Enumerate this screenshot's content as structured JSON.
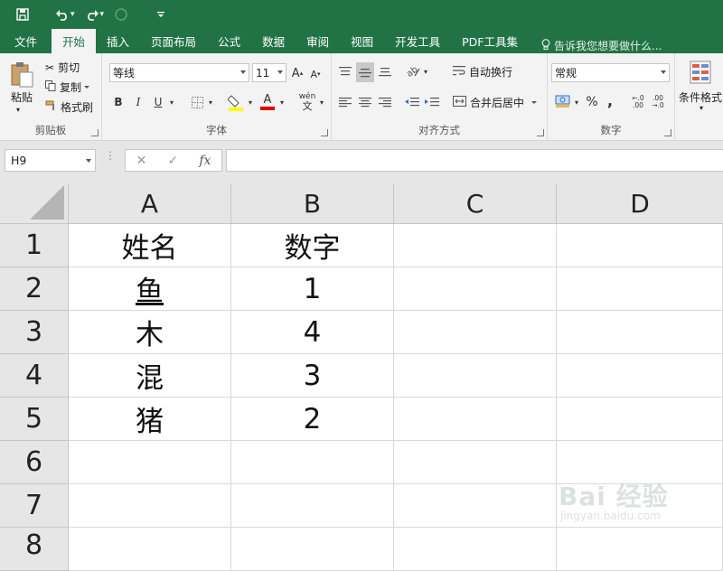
{
  "quick_access": {
    "save_icon": "save-icon",
    "undo_icon": "undo-icon",
    "redo_icon": "redo-icon",
    "customize_icon": "customize-icon"
  },
  "tabs": [
    {
      "label": "文件"
    },
    {
      "label": "开始"
    },
    {
      "label": "插入"
    },
    {
      "label": "页面布局"
    },
    {
      "label": "公式"
    },
    {
      "label": "数据"
    },
    {
      "label": "审阅"
    },
    {
      "label": "视图"
    },
    {
      "label": "开发工具"
    },
    {
      "label": "PDF工具集"
    }
  ],
  "active_tab": "开始",
  "tell_me": "告诉我您想要做什么...",
  "ribbon": {
    "clipboard": {
      "label": "剪贴板",
      "paste": "粘贴",
      "cut": "剪切",
      "copy": "复制",
      "format_painter": "格式刷"
    },
    "font": {
      "label": "字体",
      "font_name": "等线",
      "font_size": "11",
      "grow": "A",
      "shrink": "A",
      "bold": "B",
      "italic": "I",
      "underline": "U",
      "wen": "wén",
      "font_color_a": "A"
    },
    "alignment": {
      "label": "对齐方式",
      "wrap": "自动换行",
      "merge": "合并后居中"
    },
    "number": {
      "label": "数字",
      "format": "常规",
      "percent": "%",
      "comma": ","
    },
    "styles": {
      "conditional": "条件格式"
    }
  },
  "formula_bar": {
    "name_box": "H9",
    "cancel": "✕",
    "enter": "✓",
    "fx": "fx",
    "value": ""
  },
  "columns": [
    "A",
    "B",
    "C",
    "D"
  ],
  "rows": [
    {
      "num": "1",
      "a": "姓名",
      "b": "数字"
    },
    {
      "num": "2",
      "a": "鱼",
      "b": "1"
    },
    {
      "num": "3",
      "a": "木",
      "b": "4"
    },
    {
      "num": "4",
      "a": "混",
      "b": "3"
    },
    {
      "num": "5",
      "a": "猪",
      "b": "2"
    },
    {
      "num": "6",
      "a": "",
      "b": ""
    },
    {
      "num": "7",
      "a": "",
      "b": ""
    },
    {
      "num": "8",
      "a": "",
      "b": ""
    }
  ],
  "watermark": {
    "main": "Bai 经验",
    "sub": "jingyan.baidu.com"
  },
  "colors": {
    "excel_green": "#217346",
    "ribbon_bg": "#f3f3f3",
    "header_bg": "#e6e6e6"
  }
}
